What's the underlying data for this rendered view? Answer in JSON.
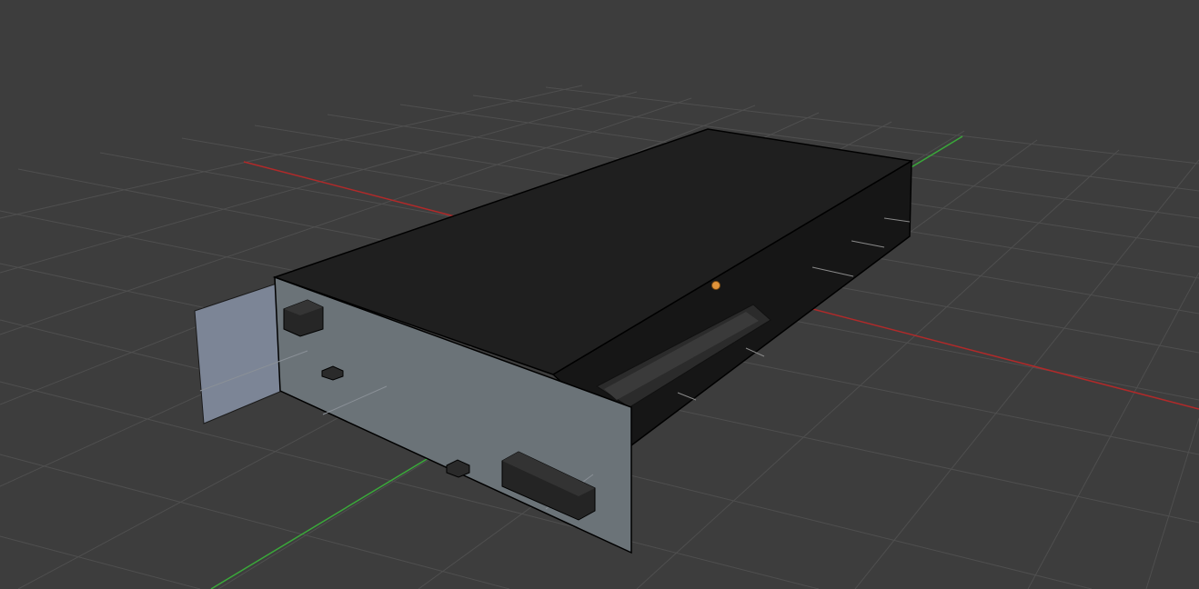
{
  "viewport": {
    "background": "#3d3d3d",
    "grid_line_color": "#4f4f4f",
    "x_axis_color": "#b02a2a",
    "y_axis_color": "#3aa83a",
    "origin_marker_color": "#e0933a"
  },
  "model": {
    "top_color": "#1f1f1f",
    "side_color": "#161616",
    "faceplate_color": "#6b7378",
    "bracket_color": "#7c8596",
    "component_color": "#2a2a2a",
    "connector_color": "#3a3a3a"
  }
}
